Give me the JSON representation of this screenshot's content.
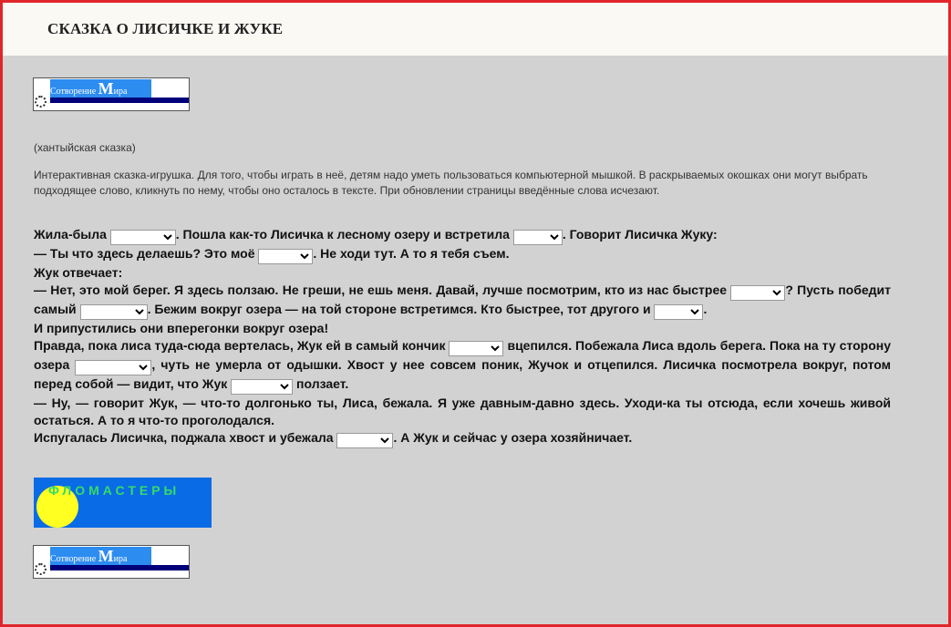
{
  "header": {
    "title": "СКАЗКА О ЛИСИЧКЕ И ЖУКЕ"
  },
  "banner": {
    "text_small_1": "Сотворение",
    "text_big": "М",
    "text_small_2": "ира"
  },
  "subtitle": "(хантыйская сказка)",
  "intro": "Интерактивная сказка-игрушка. Для того, чтобы играть в неё, детям надо уметь пользоваться компьютерной мышкой. В раскрываемых окошках они могут выбрать подходящее слово, кликнуть по нему, чтобы оно осталось в тексте. При обновлении страницы введённые слова исчезают.",
  "story": {
    "l1a": "Жила-была ",
    "l1b": ". Пошла как-то Лисичка к лесному озеру и встретила ",
    "l1c": ". Говорит Лисичка Жуку:",
    "l2a": "— Ты что здесь делаешь? Это моё ",
    "l2b": ". Не ходи тут. А то я тебя съем.",
    "l3": "Жук отвечает:",
    "l4a": "— Нет, это мой берег. Я здесь ползаю. Не греши, не ешь меня. Давай, лучше посмотрим, кто из нас быстрее ",
    "l4b": "? Пусть победит самый ",
    "l4c": ". Бежим вокруг озера — на той стороне встретимся. Кто быстрее, тот другого и ",
    "l4d": ".",
    "l5": "И припустились они вперегонки вокруг озера!",
    "l6a": "Правда, пока лиса туда-сюда вертелась, Жук ей в самый кончик ",
    "l6b": " вцепился. Побежала Лиса вдоль берега. Пока на ту сторону озера ",
    "l6c": ", чуть не умерла от одышки. Хвост у нее совсем поник, Жучок и отцепился. Лисичка посмотрела вокруг, потом перед собой — видит, что Жук ",
    "l6d": " ползает.",
    "l7": "— Ну, — говорит Жук, — что-то долгонько ты, Лиса, бежала. Я уже давным-давно здесь. Уходи-ка ты отсюда, если хочешь живой остаться. А то я что-то проголодался.",
    "l8a": "Испугалась Лисичка, поджала хвост и убежала ",
    "l8b": ". А Жук и сейчас у озера хозяйничает."
  },
  "dropdowns": {
    "selected": ""
  },
  "markers_banner": {
    "label": "ФЛОМАСТЕРЫ"
  },
  "colors": {
    "border": "#e0262b",
    "page_bg": "#d2d2d2",
    "header_bg": "#fbf9f4",
    "banner_blue": "#2d8cf0",
    "markers_blue": "#0a6be6"
  }
}
